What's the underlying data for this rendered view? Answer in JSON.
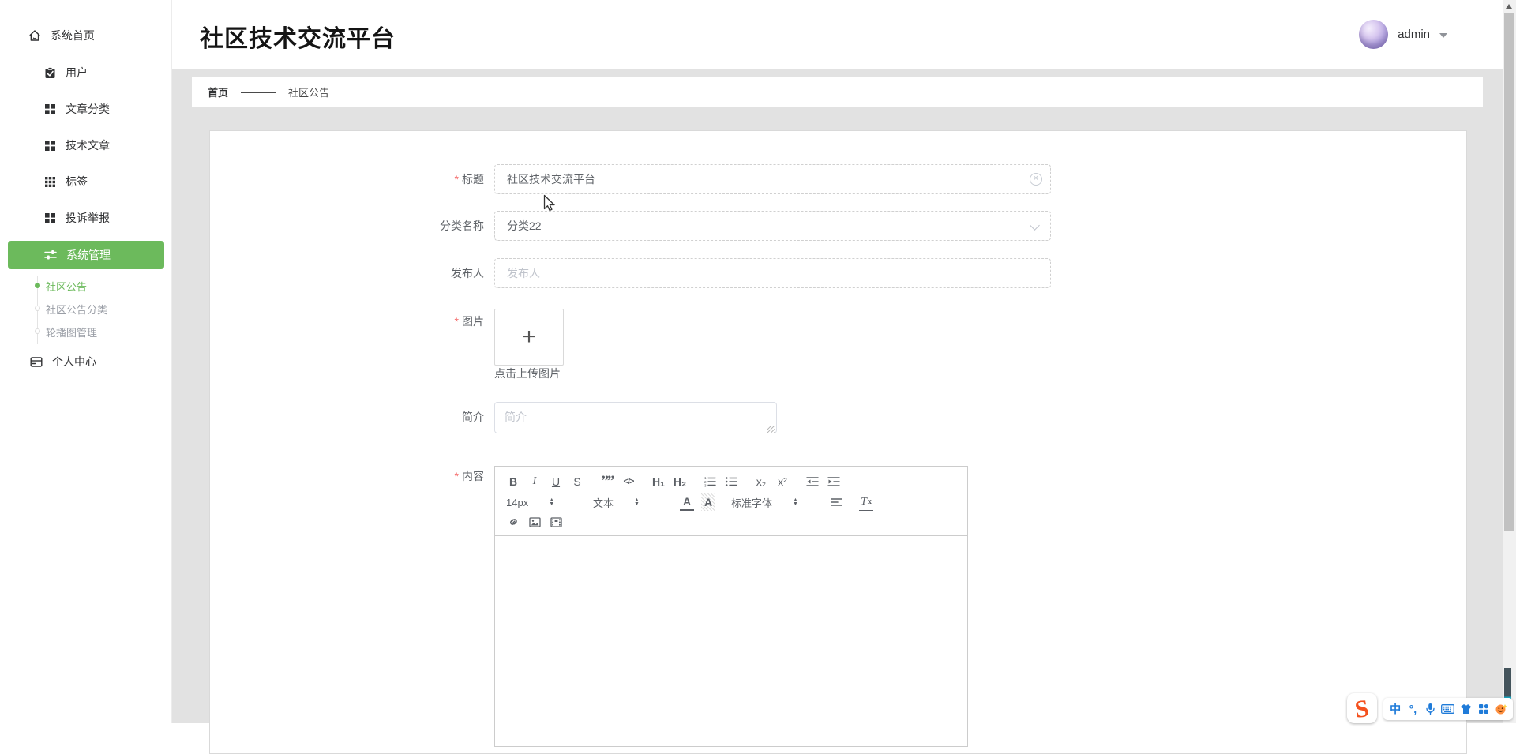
{
  "app": {
    "title": "社区技术交流平台"
  },
  "user": {
    "name": "admin"
  },
  "breadcrumb": {
    "home": "首页",
    "current": "社区公告"
  },
  "sidebar": {
    "items": [
      {
        "label": "系统首页",
        "icon": "home-icon"
      },
      {
        "label": "用户",
        "icon": "clipboard-check-icon"
      },
      {
        "label": "文章分类",
        "icon": "grid-2x2-icon"
      },
      {
        "label": "技术文章",
        "icon": "grid-2x2-icon"
      },
      {
        "label": "标签",
        "icon": "grid-3x3-icon"
      },
      {
        "label": "投诉举报",
        "icon": "grid-2x2-icon"
      },
      {
        "label": "系统管理",
        "icon": "sliders-icon",
        "active": true
      }
    ],
    "submenu": [
      {
        "label": "社区公告",
        "active": true
      },
      {
        "label": "社区公告分类",
        "active": false
      },
      {
        "label": "轮播图管理",
        "active": false
      }
    ],
    "personal": {
      "label": "个人中心",
      "icon": "id-card-icon"
    }
  },
  "form": {
    "title": {
      "label": "标题",
      "required": true,
      "value": "社区技术交流平台"
    },
    "category": {
      "label": "分类名称",
      "value": "分类22"
    },
    "publisher": {
      "label": "发布人",
      "placeholder": "发布人"
    },
    "image": {
      "label": "图片",
      "required": true,
      "plus": "+",
      "hint": "点击上传图片"
    },
    "intro": {
      "label": "简介",
      "placeholder": "简介"
    },
    "content": {
      "label": "内容",
      "required": true
    }
  },
  "editor_toolbar": {
    "bold": "B",
    "italic": "I",
    "underline": "U",
    "strike": "S",
    "quote": "””",
    "code": "</>",
    "h1": "H₁",
    "h2": "H₂",
    "subscript": "x₂",
    "superscript": "x²",
    "size_value": "14px",
    "text_value": "文本",
    "font_value": "标准字体",
    "color_label": "A",
    "highlight_label": "A",
    "clear_t": "T",
    "clear_x": "x",
    "stepper_up": "▲",
    "stepper_down": "▼"
  },
  "ime": {
    "cn_label": "中",
    "punct_label": "°,",
    "logo_letter": "S"
  },
  "colors": {
    "accent_green": "#6cba5c",
    "required_red": "#f56c6c",
    "content_bg": "#e2e2e2",
    "ime_blue": "#1f7bd9",
    "sogou_orange": "#f4511e",
    "teal_edge": "#17a9c4"
  }
}
